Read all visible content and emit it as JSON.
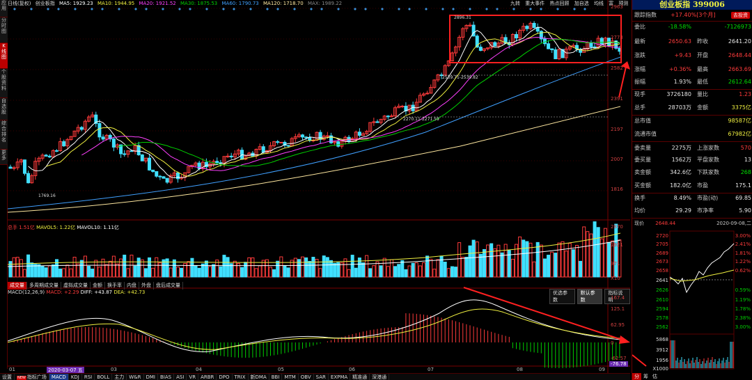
{
  "left_tabs": [
    "应用",
    "分时图",
    "K线图",
    "个股资料",
    "自选股",
    "综合排名",
    "更多"
  ],
  "ma_line": {
    "period": "日线(复权)",
    "name": "创业板指",
    "ma5": "MA5: 1929.23",
    "ma10": "MA10: 1944.95",
    "ma20": "MA20: 1921.52",
    "ma30": "MA30: 1875.53",
    "ma60": "MA60: 1790.73",
    "ma120": "MA120: 1718.70",
    "max": "MAX: 1989.22"
  },
  "top_toolbar": [
    "九转",
    "重大事件",
    "热点回顾",
    "加自选",
    "均线",
    "富",
    "预测"
  ],
  "price_axis": [
    "2963",
    "2773",
    "2582",
    "2391",
    "2197",
    "2007",
    "1816"
  ],
  "volume_axis": [
    "2870",
    "1921",
    "971",
    "X10"
  ],
  "macd_axis": [
    "167.4",
    "125.1",
    "62.95",
    "0",
    "-62.57",
    "-76.78"
  ],
  "annotations": {
    "high": "2896.31",
    "mid": "2539.71-2539.82",
    "low2": "2270.11-2271.59",
    "low": "1769.16"
  },
  "volume": {
    "header_label": "总手",
    "total": "1.51亿",
    "mavol5": "MAVOL5: 1.22亿",
    "mavol10": "MAVOL10: 1.11亿",
    "tabs": [
      "成交量",
      "多周期成交量",
      "虚拟成交量",
      "金额",
      "换手率",
      "内盘",
      "外盘",
      "盘后成交量"
    ]
  },
  "macd": {
    "label": "MACD(12,26,9)",
    "macd": "MACD: +2.29",
    "diff": "DIFF: +43.87",
    "dea": "DEA: +42.73",
    "buttons": [
      "优选参数",
      "默认参数",
      "指标说明"
    ]
  },
  "x_axis": [
    "01",
    "2020-03-07 五",
    "03",
    "04",
    "05",
    "06",
    "07",
    "08",
    "09"
  ],
  "bottom_tabs": [
    "设置",
    "指标广场",
    "MACD",
    "KDJ",
    "RSI",
    "BOLL",
    "主力",
    "W&R",
    "DMI",
    "BIAS",
    "ASI",
    "VR",
    "ARBR",
    "DPO",
    "TRIX",
    "新DMA",
    "BBI",
    "MTM",
    "OBV",
    "SAR",
    "EXPMA",
    "精准通",
    "深港通"
  ],
  "bottom_new_badge": "NEW",
  "panel": {
    "title": "创业板指 399006",
    "track_label": "跟踪指数",
    "track_value": "+17.40%[3个月]",
    "track_button": "去投资",
    "rows": [
      {
        "k": "委比",
        "v1": "-18.58%",
        "k2": "",
        "v2": "-7126973",
        "c1": "green",
        "c2": "green"
      },
      {
        "k": "最新",
        "v1": "2650.63",
        "k2": "昨收",
        "v2": "2641.20",
        "c1": "red",
        "c2": "white"
      },
      {
        "k": "涨跌",
        "v1": "+9.43",
        "k2": "开盘",
        "v2": "2648.44",
        "c1": "red",
        "c2": "red"
      },
      {
        "k": "涨幅",
        "v1": "+0.36%",
        "k2": "最高",
        "v2": "2663.69",
        "c1": "red",
        "c2": "red"
      },
      {
        "k": "振幅",
        "v1": "1.93%",
        "k2": "最低",
        "v2": "2612.64",
        "c1": "white",
        "c2": "green"
      },
      {
        "k": "现手",
        "v1": "3726180",
        "k2": "量比",
        "v2": "1.23",
        "c1": "white",
        "c2": "red"
      },
      {
        "k": "总手",
        "v1": "28703万",
        "k2": "金额",
        "v2": "3375亿",
        "c1": "white",
        "c2": "yellow"
      },
      {
        "k": "总市值",
        "v1": "",
        "k2": "",
        "v2": "98587亿",
        "c1": "white",
        "c2": "yellow"
      },
      {
        "k": "流通市值",
        "v1": "",
        "k2": "",
        "v2": "67982亿",
        "c1": "white",
        "c2": "yellow"
      },
      {
        "k": "委卖量",
        "v1": "2275万",
        "k2": "上涨家数",
        "v2": "570",
        "c1": "white",
        "c2": "red"
      },
      {
        "k": "委买量",
        "v1": "1562万",
        "k2": "平盘家数",
        "v2": "13",
        "c1": "white",
        "c2": "white"
      },
      {
        "k": "卖金额",
        "v1": "342.6亿",
        "k2": "下跌家数",
        "v2": "268",
        "c1": "white",
        "c2": "green"
      },
      {
        "k": "买金额",
        "v1": "182.0亿",
        "k2": "市盈",
        "v2": "175.1",
        "c1": "white",
        "c2": "white"
      },
      {
        "k": "换手",
        "v1": "8.49%",
        "k2": "市盈(动)",
        "v2": "69.85",
        "c1": "white",
        "c2": "white"
      },
      {
        "k": "均价",
        "v1": "29.29",
        "k2": "市净率",
        "v2": "5.90",
        "c1": "white",
        "c2": "white"
      }
    ],
    "mini_header_left": "现价",
    "mini_header_price": "2648.44",
    "mini_header_date": "2020-09-08,二",
    "mini_axis_left": [
      "2720",
      "2705",
      "2689",
      "2673",
      "2658",
      "2641",
      "2626",
      "2610",
      "2594",
      "2578",
      "2562",
      "5868",
      "3912",
      "1956",
      "X1000"
    ],
    "mini_axis_right": [
      "3.00%",
      "2.41%",
      "1.81%",
      "1.22%",
      "0.62%",
      "",
      "0.59%",
      "1.19%",
      "1.78%",
      "2.38%",
      "3.00%"
    ],
    "mini_tabs": [
      "分",
      "筹",
      "估"
    ]
  },
  "colors": {
    "up": "#ff3b3b",
    "down": "#40e0ff",
    "ma5": "#ffffff",
    "ma10": "#f0f040",
    "ma20": "#ff40ff",
    "ma30": "#00d000",
    "ma60": "#40a0ff",
    "ma120": "#ffe8a0",
    "highlight_box": "#ff2020"
  }
}
